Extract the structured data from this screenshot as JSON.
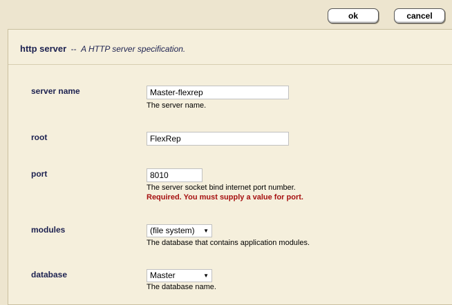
{
  "toolbar": {
    "ok_label": "ok",
    "cancel_label": "cancel"
  },
  "header": {
    "title": "http server",
    "separator": "--",
    "description": "A HTTP server specification."
  },
  "fields": {
    "server_name": {
      "label": "server name",
      "value": "Master-flexrep",
      "help": "The server name."
    },
    "root": {
      "label": "root",
      "value": "FlexRep"
    },
    "port": {
      "label": "port",
      "value": "8010",
      "help": "The server socket bind internet port number.",
      "error": "Required. You must supply a value for port."
    },
    "modules": {
      "label": "modules",
      "value": "(file system)",
      "help": "The database that contains application modules."
    },
    "database": {
      "label": "database",
      "value": "Master",
      "help": "The database name."
    }
  },
  "colors": {
    "page_bg": "#ede5cf",
    "panel_bg": "#f5efdc",
    "label_color": "#1c2150",
    "error_color": "#a61010"
  }
}
